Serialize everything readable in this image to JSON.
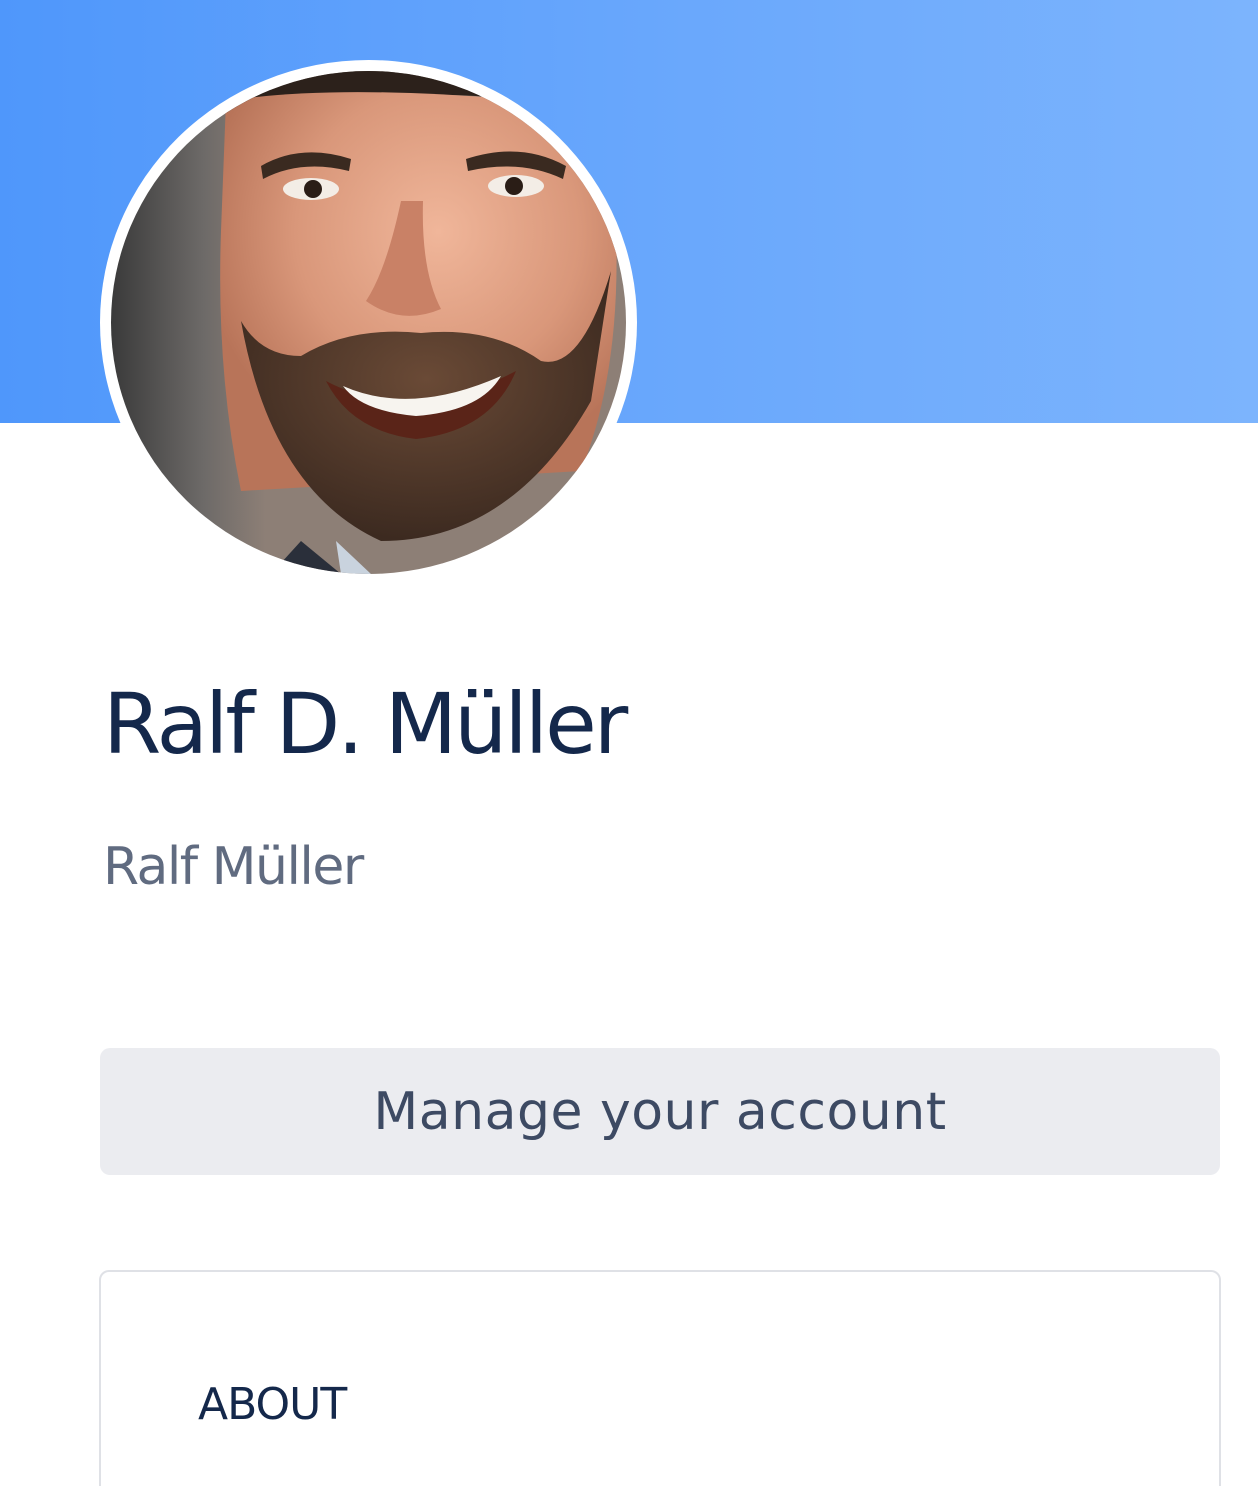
{
  "profile": {
    "display_name": "Ralf D. Müller",
    "username": "Ralf Müller",
    "avatar_icon": "profile-photo"
  },
  "actions": {
    "manage_account_label": "Manage your account"
  },
  "about": {
    "heading": "ABOUT"
  },
  "colors": {
    "banner_start": "#4f97fb",
    "banner_end": "#7cb4fd",
    "name_text": "#14284b",
    "username_text": "#606b80",
    "button_bg": "#ebecf0",
    "button_text": "#3d4a63"
  }
}
